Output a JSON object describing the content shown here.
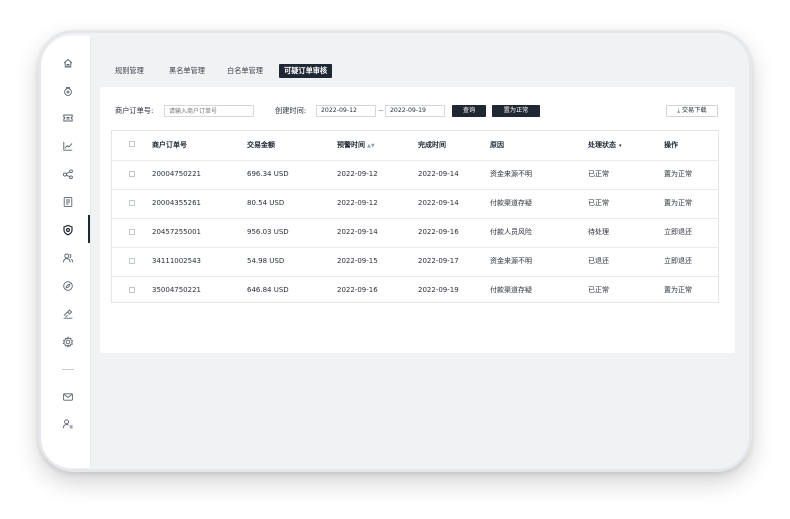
{
  "tabs": [
    {
      "label": "规则管理"
    },
    {
      "label": "黑名单管理"
    },
    {
      "label": "白名单管理"
    },
    {
      "label": "可疑订单审核"
    }
  ],
  "filters": {
    "order_label": "商户订单号:",
    "order_placeholder": "请输入商户订单号",
    "date_label": "创建时间:",
    "date_from": "2022-09-12",
    "date_sep": "~",
    "date_to": "2022-09-19",
    "query_label": "查询",
    "set_normal_label": "置为正常",
    "download_label": "交易下载",
    "download_icon": "download-icon"
  },
  "table": {
    "headers": {
      "order_no": "商户订单号",
      "amount": "交易金额",
      "alert_time": "预警时间",
      "alert_sort": "▲▼",
      "done_time": "完成时间",
      "reason": "原因",
      "status": "处理状态",
      "status_caret": "▾",
      "action": "操作"
    },
    "rows": [
      {
        "order_no": "20004750221",
        "amount": "696.34 USD",
        "alert_time": "2022-09-12",
        "done_time": "2022-09-14",
        "reason": "资金来源不明",
        "status": "已正常",
        "action": "置为正常"
      },
      {
        "order_no": "20004355261",
        "amount": "80.54 USD",
        "alert_time": "2022-09-12",
        "done_time": "2022-09-14",
        "reason": "付款渠道存疑",
        "status": "已正常",
        "action": "置为正常"
      },
      {
        "order_no": "20457255001",
        "amount": "956.03 USD",
        "alert_time": "2022-09-14",
        "done_time": "2022-09-16",
        "reason": "付款人员风险",
        "status": "待处理",
        "action": "立即退还"
      },
      {
        "order_no": "34111002543",
        "amount": "54.98 USD",
        "alert_time": "2022-09-15",
        "done_time": "2022-09-17",
        "reason": "资金来源不明",
        "status": "已退还",
        "action": "立即退还"
      },
      {
        "order_no": "35004750221",
        "amount": "646.84 USD",
        "alert_time": "2022-09-16",
        "done_time": "2022-09-19",
        "reason": "付款渠道存疑",
        "status": "已正常",
        "action": "置为正常"
      }
    ]
  },
  "sidebar": {
    "icons": [
      "home-icon",
      "lock-icon",
      "ticket-icon",
      "chart-icon",
      "share-icon",
      "document-icon",
      "shield-icon",
      "users-icon",
      "compass-icon",
      "hand-icon",
      "settings-icon",
      "mail-icon",
      "user-list-icon"
    ],
    "active": "shield-icon"
  },
  "colors": {
    "accent": "#1f2733",
    "device_bg": "#f1f2f4"
  }
}
